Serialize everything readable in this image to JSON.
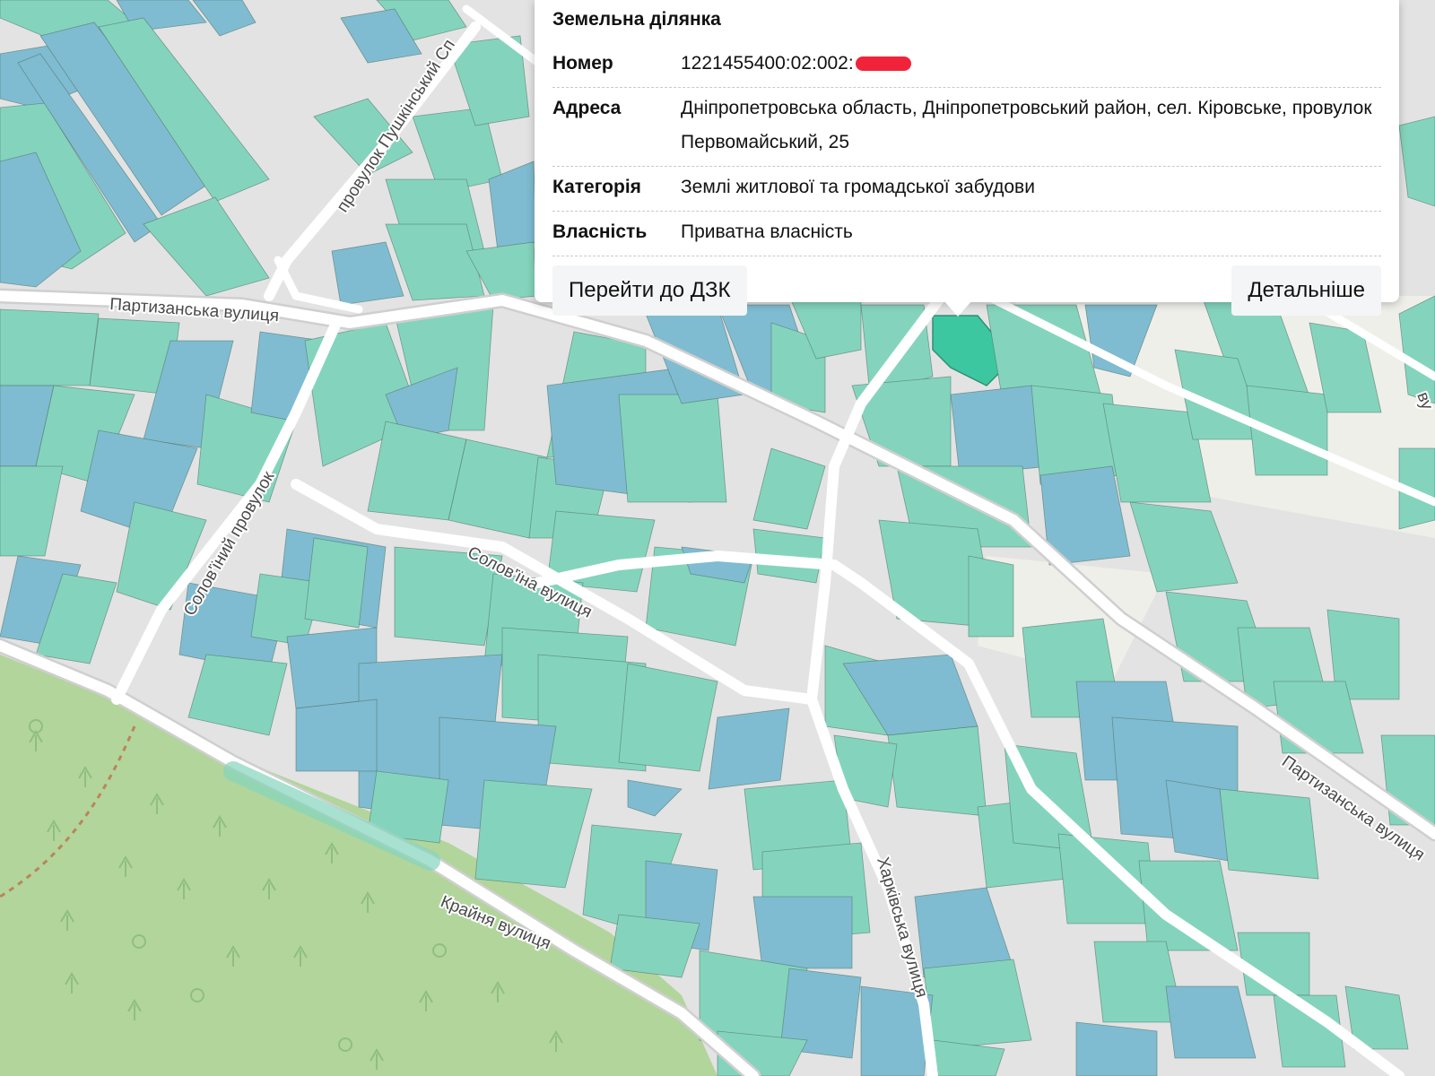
{
  "popup": {
    "title": "Земельна ділянка",
    "fields": [
      {
        "label": "Номер",
        "value": "1221455400:02:002:",
        "redacted": true
      },
      {
        "label": "Адреса",
        "value": "Дніпропетровська область, Дніпропетровський район, сел. Кіровське, провулок Первомайський, 25"
      },
      {
        "label": "Категорія",
        "value": "Землі житлової та громадської забудови"
      },
      {
        "label": "Власність",
        "value": "Приватна власність"
      }
    ],
    "buttons": {
      "left": "Перейти до ДЗК",
      "right": "Детальніше"
    }
  },
  "streets": {
    "pushkin": "провулок Пушкінський Сп",
    "partyzanska_1": "Партизанська вулиця",
    "partyzanska_2": "Партизанська вулиця",
    "solovyinyi_provulok": "Солов'їний провулок",
    "solovyina": "Солов'їна вулиця",
    "kraina": "Крайня вулиця",
    "kharkivska": "Харківська вулиця",
    "edge_v": "ву"
  },
  "colors": {
    "background": "#e3e3e3",
    "road": "#ffffff",
    "parcel_green": "#84d4bd",
    "parcel_blue": "#7fbcd1",
    "parcel_selected": "#3cc7a0",
    "forest": "#b2d59c",
    "redaction": "#f0233a"
  }
}
